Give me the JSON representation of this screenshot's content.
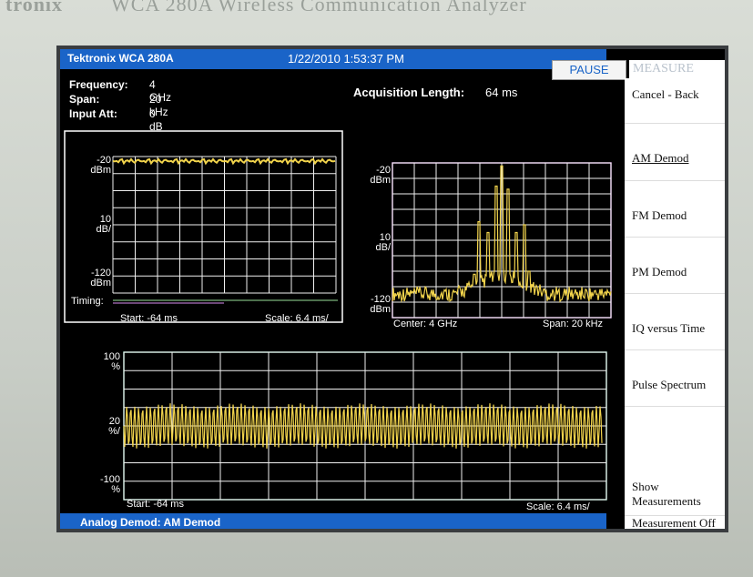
{
  "bezel": {
    "brand": "tronix",
    "model": "WCA 280A Wireless Communication Analyzer"
  },
  "titlebar": {
    "brand": "Tektronix  WCA 280A",
    "datetime": "1/22/2010 1:53:37 PM",
    "pause_label": "PAUSE"
  },
  "measure_menu": {
    "title": "MEASURE",
    "items": [
      "Cancel - Back",
      "AM Demod",
      "FM Demod",
      "PM Demod",
      "IQ versus Time",
      "Pulse Spectrum",
      "Show Measurements",
      "Measurement Off"
    ]
  },
  "settings": {
    "frequency_label": "Frequency:",
    "frequency_value": "4 GHz",
    "span_label": "Span:",
    "span_value": "20 kHz",
    "input_att_label": "Input Att:",
    "input_att_value": "0 dB",
    "acq_label": "Acquisition Length:",
    "acq_value": "64 ms"
  },
  "plot_top_left": {
    "y_top": "-20\ndBm",
    "y_mid": "10\ndB/",
    "y_bot": "-120\ndBm",
    "timing_label": "Timing:",
    "start": "Start: -64 ms",
    "scale": "Scale: 6.4 ms/"
  },
  "plot_top_right": {
    "y_top": "-20\ndBm",
    "y_mid": "10\ndB/",
    "y_bot": "-120\ndBm",
    "center": "Center: 4 GHz",
    "span": "Span: 20 kHz"
  },
  "plot_bottom": {
    "y_top": "100\n%",
    "y_mid": "20\n%/",
    "y_bot": "-100\n%",
    "start": "Start: -64 ms",
    "scale": "Scale: 6.4 ms/"
  },
  "status": {
    "bottom_label": "Analog Demod: AM Demod"
  },
  "colors": {
    "title_blue": "#1a64c8",
    "trace_yellow": "#f2d44c",
    "grid_white": "#f0f0f0"
  }
}
